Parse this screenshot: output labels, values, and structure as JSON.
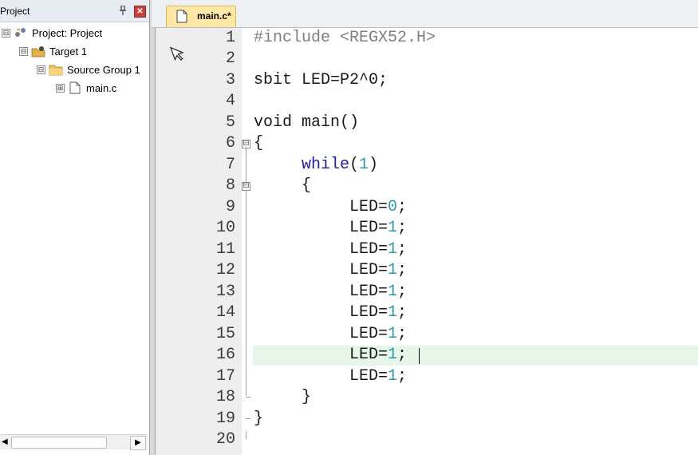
{
  "project_panel": {
    "title": "Project",
    "pin_icon": "pin-icon",
    "close_label": "✕",
    "tree": [
      {
        "label": "Project: Project",
        "expander": "⊟",
        "icon": "project-icon"
      },
      {
        "label": "Target 1",
        "expander": "⊟",
        "icon": "target-icon"
      },
      {
        "label": "Source Group 1",
        "expander": "⊟",
        "icon": "folder-icon"
      },
      {
        "label": "main.c",
        "expander": "⊞",
        "icon": "file-icon"
      }
    ],
    "scroll_left": "◀",
    "scroll_right": "▶"
  },
  "editor": {
    "tab_label": "main.c*",
    "lines": [
      {
        "no": "1"
      },
      {
        "no": "2"
      },
      {
        "no": "3"
      },
      {
        "no": "4"
      },
      {
        "no": "5"
      },
      {
        "no": "6"
      },
      {
        "no": "7"
      },
      {
        "no": "8"
      },
      {
        "no": "9"
      },
      {
        "no": "10"
      },
      {
        "no": "11"
      },
      {
        "no": "12"
      },
      {
        "no": "13"
      },
      {
        "no": "14"
      },
      {
        "no": "15"
      },
      {
        "no": "16"
      },
      {
        "no": "17"
      },
      {
        "no": "18"
      },
      {
        "no": "19"
      },
      {
        "no": "20"
      }
    ],
    "code": {
      "l1_pre": "#include",
      "l1_arg": " <REGX52.H>",
      "l3": "sbit LED=P2^0;",
      "l5": "void main()",
      "l6": "{",
      "l7_kw": "while",
      "l7_open": "(",
      "l7_num": "1",
      "l7_close": ")",
      "l8": "{",
      "assign_text": "LED=",
      "l9_val": "0",
      "one_val": "1",
      "semi": ";",
      "l18": "}",
      "l19": "}"
    },
    "fold_open": "⊟",
    "highlight_color": "#e6f7e9"
  }
}
